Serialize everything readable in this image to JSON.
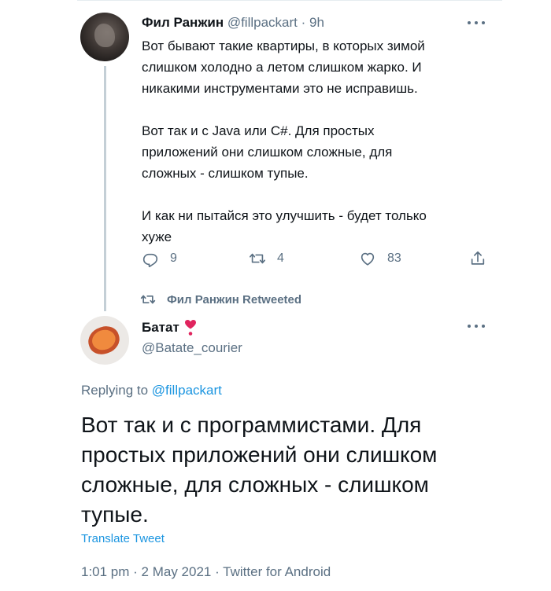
{
  "tweet1": {
    "author_name": "Фил Ранжин",
    "handle": "@fillpackart",
    "separator": "·",
    "time": "9h",
    "text": "Вот бывают такие квартиры, в которых зимой\nслишком холодно а летом слишком жарко. И\nникакими инструментами это не исправишь.\n\nВот так и с Java или C#. Для простых\nприложений они слишком сложные, для\nсложных - слишком тупые.\n\nИ как ни пытайся это улучшить - будет только\nхуже",
    "actions": {
      "replies": "9",
      "retweets": "4",
      "likes": "83"
    },
    "icons": {
      "reply": "reply-icon",
      "retweet": "retweet-icon",
      "like": "like-icon",
      "share": "share-icon",
      "more": "more-icon"
    }
  },
  "retweet_notice": {
    "text": "Фил Ранжин Retweeted"
  },
  "tweet2": {
    "author_name": "Батат",
    "emoji": "heart-exclamation-icon",
    "handle": "@Batate_courier",
    "replying_prefix": "Replying to",
    "replying_to": "@fillpackart",
    "text": "Вот так и с программистами. Для простых приложений они слишком сложные, для сложных - слишком тупые.",
    "translate_label": "Translate Tweet",
    "meta": "1:01 pm · 2 May 2021 · Twitter for Android"
  },
  "colors": {
    "text": "#0f1419",
    "secondary": "#5b7083",
    "link": "#1b95e0",
    "thread_line": "#c4cfd6",
    "heart_emoji": "#e0245e"
  }
}
